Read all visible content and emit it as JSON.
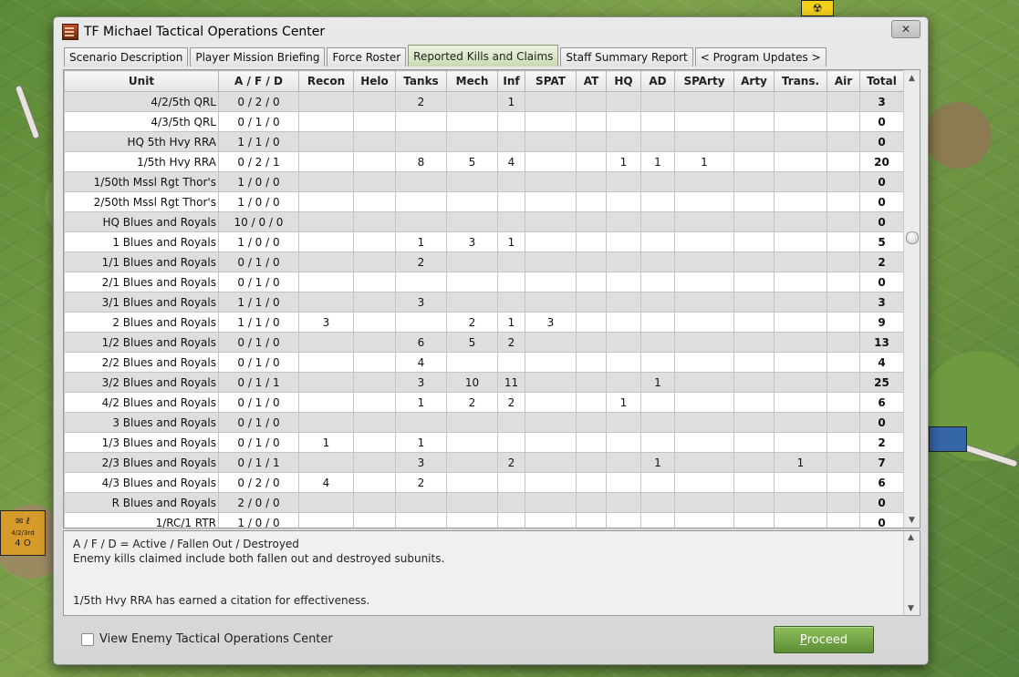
{
  "window": {
    "title": "TF Michael Tactical Operations Center",
    "close_glyph": "✕"
  },
  "tabs": [
    {
      "label": "Scenario Description"
    },
    {
      "label": "Player Mission Briefing"
    },
    {
      "label": "Force Roster"
    },
    {
      "label": "Reported Kills and Claims",
      "active": true
    },
    {
      "label": "Staff Summary Report"
    },
    {
      "label": "< Program Updates >"
    }
  ],
  "table": {
    "columns": [
      "Unit",
      "A / F / D",
      "Recon",
      "Helo",
      "Tanks",
      "Mech",
      "Inf",
      "SPAT",
      "AT",
      "HQ",
      "AD",
      "SPArty",
      "Arty",
      "Trans.",
      "Air",
      "Total"
    ],
    "rows": [
      [
        "4/2/5th QRL",
        "0 / 2 / 0",
        "",
        "",
        "2",
        "",
        "1",
        "",
        "",
        "",
        "",
        "",
        "",
        "",
        "",
        "3"
      ],
      [
        "4/3/5th QRL",
        "0 / 1 / 0",
        "",
        "",
        "",
        "",
        "",
        "",
        "",
        "",
        "",
        "",
        "",
        "",
        "",
        "0"
      ],
      [
        "HQ 5th Hvy RRA",
        "1 / 1 / 0",
        "",
        "",
        "",
        "",
        "",
        "",
        "",
        "",
        "",
        "",
        "",
        "",
        "",
        "0"
      ],
      [
        "1/5th Hvy RRA",
        "0 / 2 / 1",
        "",
        "",
        "8",
        "5",
        "4",
        "",
        "",
        "1",
        "1",
        "1",
        "",
        "",
        "",
        "20"
      ],
      [
        "1/50th Mssl Rgt Thor's",
        "1 / 0 / 0",
        "",
        "",
        "",
        "",
        "",
        "",
        "",
        "",
        "",
        "",
        "",
        "",
        "",
        "0"
      ],
      [
        "2/50th Mssl Rgt Thor's",
        "1 / 0 / 0",
        "",
        "",
        "",
        "",
        "",
        "",
        "",
        "",
        "",
        "",
        "",
        "",
        "",
        "0"
      ],
      [
        "HQ Blues and Royals",
        "10 / 0 / 0",
        "",
        "",
        "",
        "",
        "",
        "",
        "",
        "",
        "",
        "",
        "",
        "",
        "",
        "0"
      ],
      [
        "1 Blues and Royals",
        "1 / 0 / 0",
        "",
        "",
        "1",
        "3",
        "1",
        "",
        "",
        "",
        "",
        "",
        "",
        "",
        "",
        "5"
      ],
      [
        "1/1 Blues and Royals",
        "0 / 1 / 0",
        "",
        "",
        "2",
        "",
        "",
        "",
        "",
        "",
        "",
        "",
        "",
        "",
        "",
        "2"
      ],
      [
        "2/1 Blues and Royals",
        "0 / 1 / 0",
        "",
        "",
        "",
        "",
        "",
        "",
        "",
        "",
        "",
        "",
        "",
        "",
        "",
        "0"
      ],
      [
        "3/1 Blues and Royals",
        "1 / 1 / 0",
        "",
        "",
        "3",
        "",
        "",
        "",
        "",
        "",
        "",
        "",
        "",
        "",
        "",
        "3"
      ],
      [
        "2 Blues and Royals",
        "1 / 1 / 0",
        "3",
        "",
        "",
        "2",
        "1",
        "3",
        "",
        "",
        "",
        "",
        "",
        "",
        "",
        "9"
      ],
      [
        "1/2 Blues and Royals",
        "0 / 1 / 0",
        "",
        "",
        "6",
        "5",
        "2",
        "",
        "",
        "",
        "",
        "",
        "",
        "",
        "",
        "13"
      ],
      [
        "2/2 Blues and Royals",
        "0 / 1 / 0",
        "",
        "",
        "4",
        "",
        "",
        "",
        "",
        "",
        "",
        "",
        "",
        "",
        "",
        "4"
      ],
      [
        "3/2 Blues and Royals",
        "0 / 1 / 1",
        "",
        "",
        "3",
        "10",
        "11",
        "",
        "",
        "",
        "1",
        "",
        "",
        "",
        "",
        "25"
      ],
      [
        "4/2 Blues and Royals",
        "0 / 1 / 0",
        "",
        "",
        "1",
        "2",
        "2",
        "",
        "",
        "1",
        "",
        "",
        "",
        "",
        "",
        "6"
      ],
      [
        "3 Blues and Royals",
        "0 / 1 / 0",
        "",
        "",
        "",
        "",
        "",
        "",
        "",
        "",
        "",
        "",
        "",
        "",
        "",
        "0"
      ],
      [
        "1/3 Blues and Royals",
        "0 / 1 / 0",
        "1",
        "",
        "1",
        "",
        "",
        "",
        "",
        "",
        "",
        "",
        "",
        "",
        "",
        "2"
      ],
      [
        "2/3 Blues and Royals",
        "0 / 1 / 1",
        "",
        "",
        "3",
        "",
        "2",
        "",
        "",
        "",
        "1",
        "",
        "",
        "1",
        "",
        "7"
      ],
      [
        "4/3 Blues and Royals",
        "0 / 2 / 0",
        "4",
        "",
        "2",
        "",
        "",
        "",
        "",
        "",
        "",
        "",
        "",
        "",
        "",
        "6"
      ],
      [
        "R Blues and Royals",
        "2 / 0 / 0",
        "",
        "",
        "",
        "",
        "",
        "",
        "",
        "",
        "",
        "",
        "",
        "",
        "",
        "0"
      ],
      [
        "1/RC/1 RTR",
        "1 / 0 / 0",
        "",
        "",
        "",
        "",
        "",
        "",
        "",
        "",
        "",
        "",
        "",
        "",
        "",
        "0"
      ]
    ]
  },
  "notes": {
    "lines": [
      "A / F / D = Active / Fallen Out / Destroyed",
      "Enemy kills claimed include both fallen out and destroyed subunits.",
      "",
      "1/5th Hvy RRA has earned a citation for effectiveness."
    ]
  },
  "footer": {
    "checkbox_label": "View Enemy Tactical Operations Center",
    "checkbox_checked": false,
    "proceed_label": "Proceed",
    "proceed_accesskey": "P"
  },
  "scroll": {
    "up_glyph": "▲",
    "down_glyph": "▼"
  },
  "map": {
    "counter_labels": [
      "4/2/3rd",
      "4  O"
    ]
  }
}
